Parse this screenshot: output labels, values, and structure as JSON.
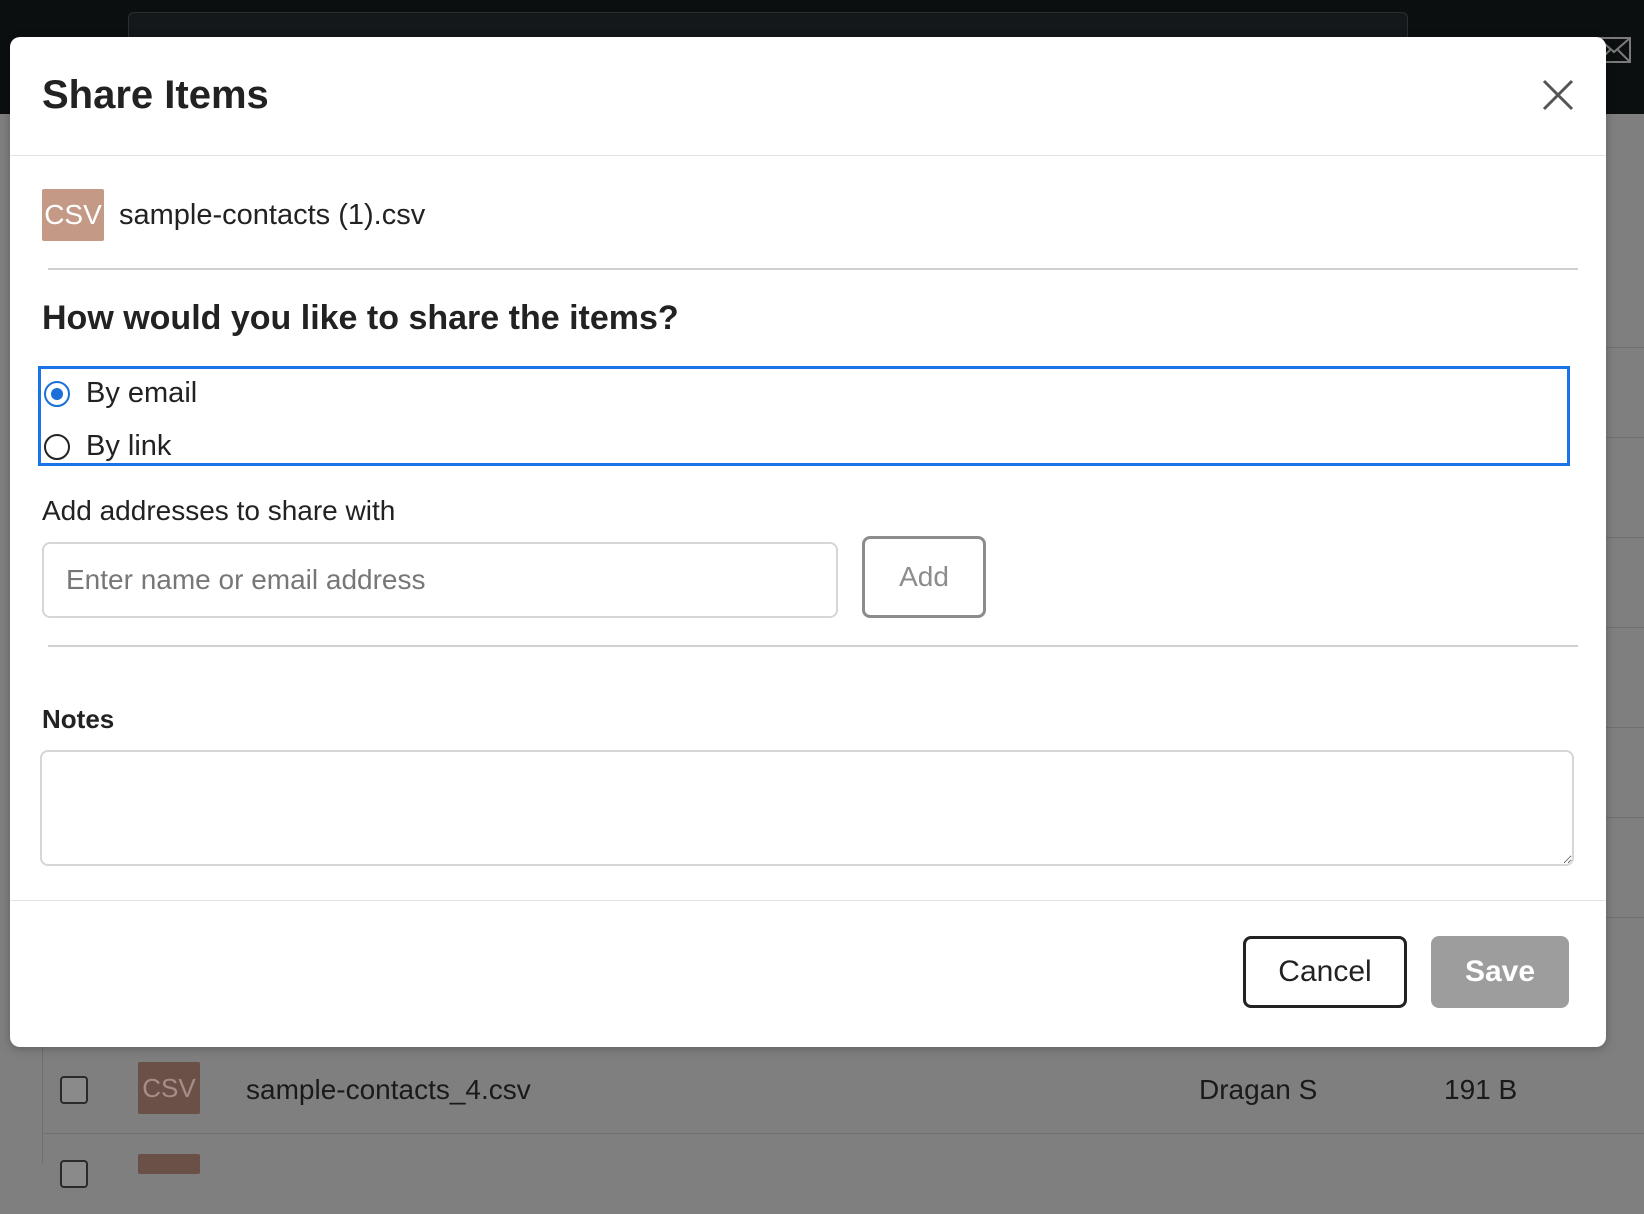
{
  "background": {
    "rows": [
      {
        "icon_label": "CSV",
        "name": "sample-contacts_4.csv",
        "owner": "Dragan S",
        "size": "191 B"
      }
    ]
  },
  "dialog": {
    "title": "Share Items",
    "close_icon": "close-icon",
    "file": {
      "icon_label": "CSV",
      "name": "sample-contacts (1).csv"
    },
    "question": "How would you like to share the items?",
    "options": [
      {
        "label": "By email",
        "selected": true
      },
      {
        "label": "By link",
        "selected": false
      }
    ],
    "addresses": {
      "label": "Add addresses to share with",
      "placeholder": "Enter name or email address",
      "value": "",
      "add_label": "Add"
    },
    "notes": {
      "label": "Notes",
      "value": ""
    },
    "footer": {
      "cancel_label": "Cancel",
      "save_label": "Save"
    }
  },
  "colors": {
    "accent": "#1a73e8",
    "csv_icon": "#c49a87",
    "save_disabled": "#9d9d9d",
    "overlay": "#7f7f7f"
  }
}
